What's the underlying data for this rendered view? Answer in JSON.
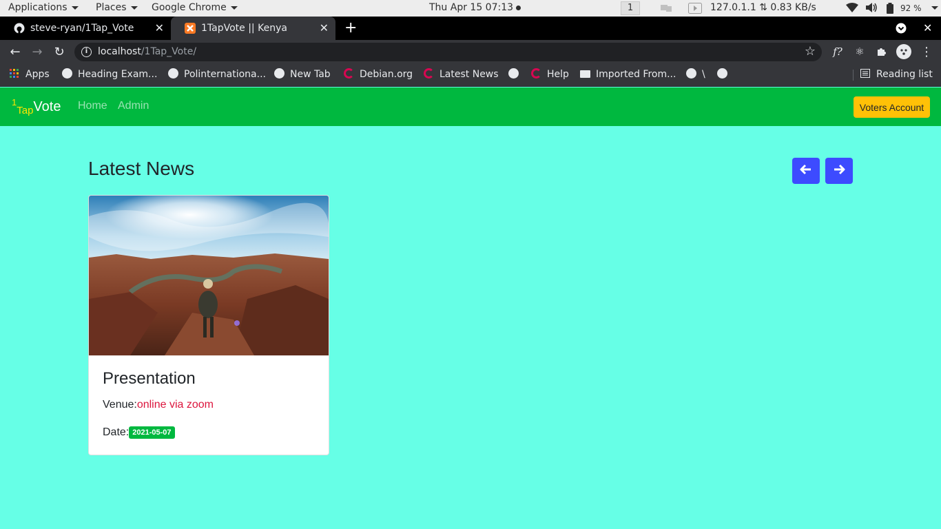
{
  "system_bar": {
    "applications": "Applications",
    "places": "Places",
    "app_name": "Google Chrome",
    "datetime": "Thu Apr 15  07:13",
    "workspace": "1",
    "network": "127.0.1.1 ⇅ 0.83 KB/s",
    "battery": "92 %"
  },
  "browser": {
    "tabs": [
      {
        "title": "steve-ryan/1Tap_Vote",
        "icon": "github-icon"
      },
      {
        "title": "1TapVote || Kenya",
        "icon": "xampp-icon",
        "active": true
      }
    ],
    "url_host": "localhost",
    "url_path": "/1Tap_Vote/",
    "bookmarks": [
      {
        "label": "Apps",
        "icon": "apps-grid-icon"
      },
      {
        "label": "Heading Exam...",
        "icon": "globe-icon"
      },
      {
        "label": "Polinternationa...",
        "icon": "globe-icon"
      },
      {
        "label": "New Tab",
        "icon": "globe-icon"
      },
      {
        "label": "Debian.org",
        "icon": "debian-icon"
      },
      {
        "label": "Latest News",
        "icon": "debian-icon"
      },
      {
        "label": "",
        "icon": "globe-icon"
      },
      {
        "label": "Help",
        "icon": "debian-icon"
      },
      {
        "label": "Imported From...",
        "icon": "folder-icon"
      },
      {
        "label": "\\",
        "icon": "globe-icon"
      },
      {
        "label": "",
        "icon": "globe-icon"
      }
    ],
    "reading_list": "Reading list"
  },
  "site": {
    "brand": {
      "one": "1",
      "tap": "Tap",
      "vote": "Vote"
    },
    "nav": {
      "home": "Home",
      "admin": "Admin"
    },
    "voters_button": "Voters Account",
    "brand_color": "#00b83f",
    "accent_color": "#ffc107",
    "page_bg": "#66ffe6"
  },
  "main": {
    "heading": "Latest News",
    "prev_icon": "arrow-left-icon",
    "next_icon": "arrow-right-icon",
    "card": {
      "title": "Presentation",
      "venue_label": "Venue:",
      "venue_value": "online via zoom",
      "date_label": "Date:",
      "date_value": "2021-05-07"
    }
  }
}
